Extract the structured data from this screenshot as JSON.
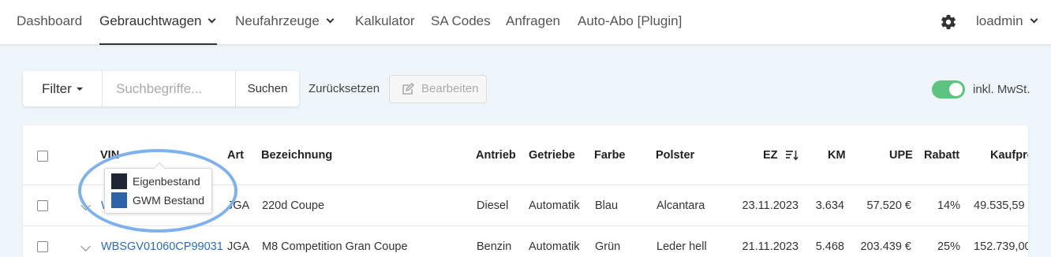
{
  "nav": {
    "items": [
      {
        "label": "Dashboard"
      },
      {
        "label": "Gebrauchtwagen"
      },
      {
        "label": "Neufahrzeuge"
      },
      {
        "label": "Kalkulator"
      },
      {
        "label": "SA Codes"
      },
      {
        "label": "Anfragen"
      },
      {
        "label": "Auto-Abo [Plugin]"
      }
    ],
    "user": "loadmin",
    "settings_icon": "gear-icon"
  },
  "toolbar": {
    "filter_label": "Filter",
    "search_placeholder": "Suchbegriffe...",
    "search_label": "Suchen",
    "reset_label": "Zurücksetzen",
    "edit_label": "Bearbeiten",
    "vat_label": "inkl. MwSt.",
    "vat_enabled": true
  },
  "table": {
    "columns": [
      "VIN",
      "Art",
      "Bezeichnung",
      "Antrieb",
      "Getriebe",
      "Farbe",
      "Polster",
      "EZ",
      "KM",
      "UPE",
      "Rabatt",
      "Kaufpre"
    ],
    "sorted_column": "EZ",
    "rows": [
      {
        "vin": "W",
        "art": "JGA",
        "bezeichnung": "220d Coupe",
        "antrieb": "Diesel",
        "getriebe": "Automatik",
        "farbe": "Blau",
        "polster": "Alcantara",
        "ez": "23.11.2023",
        "km": "3.634",
        "upe": "57.520 €",
        "rabatt": "14%",
        "kaufpreis": "49.535,59"
      },
      {
        "vin": "WBSGV01060CP99031",
        "art": "JGA",
        "bezeichnung": "M8 Competition Gran Coupe",
        "antrieb": "Benzin",
        "getriebe": "Automatik",
        "farbe": "Grün",
        "polster": "Leder hell",
        "ez": "21.11.2023",
        "km": "5.468",
        "upe": "203.439 €",
        "rabatt": "25%",
        "kaufpreis": "152.739,00"
      }
    ]
  },
  "tooltip": {
    "items": [
      {
        "label": "Eigenbestand",
        "color": "#1e2535"
      },
      {
        "label": "GWM Bestand",
        "color": "#2d64a8"
      }
    ]
  },
  "colors": {
    "accent": "#2a6bb5",
    "toggle": "#5dc47f",
    "highlight": "#7fb1ec"
  }
}
